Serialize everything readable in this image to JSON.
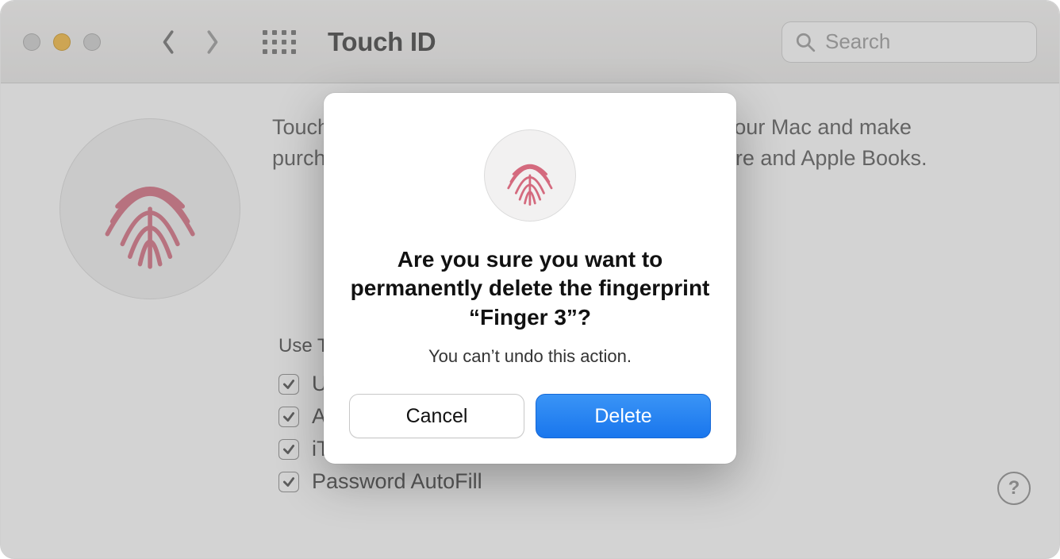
{
  "window": {
    "title": "Touch ID",
    "search_placeholder": "Search"
  },
  "content": {
    "description": "Touch ID lets you use your fingerprint to unlock your Mac and make purchases with Apple Pay, iTunes Store, App Store and Apple Books.",
    "finger_label": "Finger 3",
    "use_heading": "Use Touch ID for:",
    "checks": {
      "unlock": "Unlocking your Mac",
      "applepay": "Apple Pay",
      "stores": "iTunes Store, App Store & Apple Books",
      "autofill": "Password AutoFill"
    }
  },
  "modal": {
    "heading": "Are you sure you want to permanently delete the fingerprint “Finger 3”?",
    "subtext": "You can’t undo this action.",
    "cancel": "Cancel",
    "delete": "Delete"
  },
  "help": "?"
}
